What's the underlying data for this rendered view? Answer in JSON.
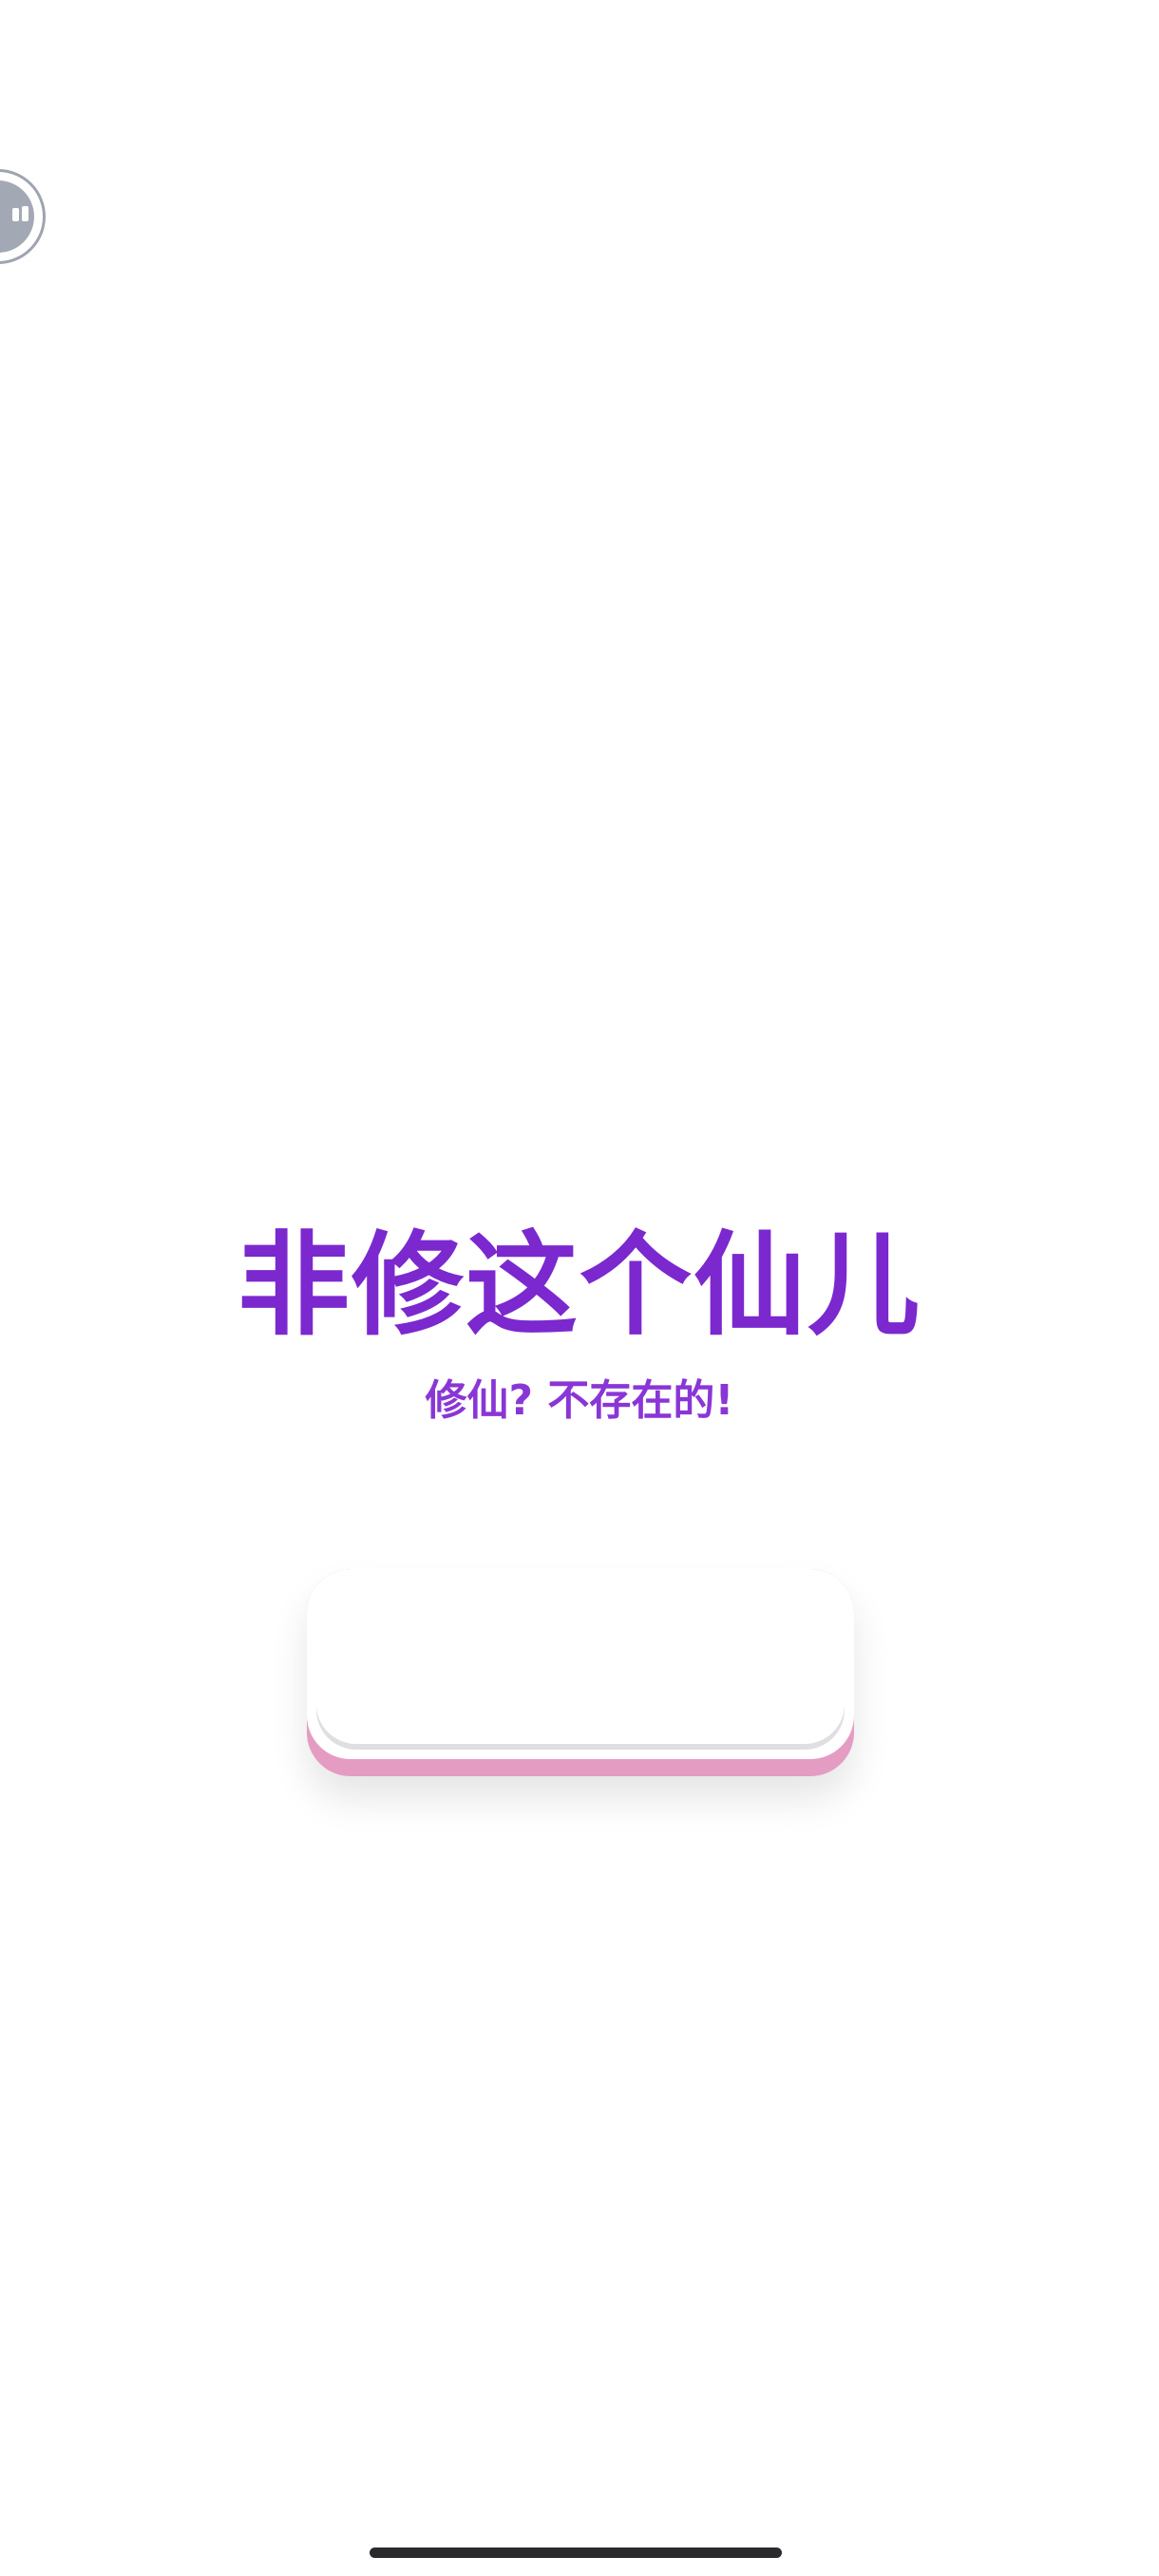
{
  "app": {
    "title": "非修这个仙儿",
    "subtitle": "修仙? 不存在的!"
  },
  "start_button": {
    "label": ""
  },
  "floating_bubble": {
    "icon": "assistive-touch-icon"
  },
  "colors": {
    "title": "#7b28cf",
    "subtitle": "#8a36d6",
    "button_base": "#e49cc2",
    "button_face": "#ffffff"
  }
}
